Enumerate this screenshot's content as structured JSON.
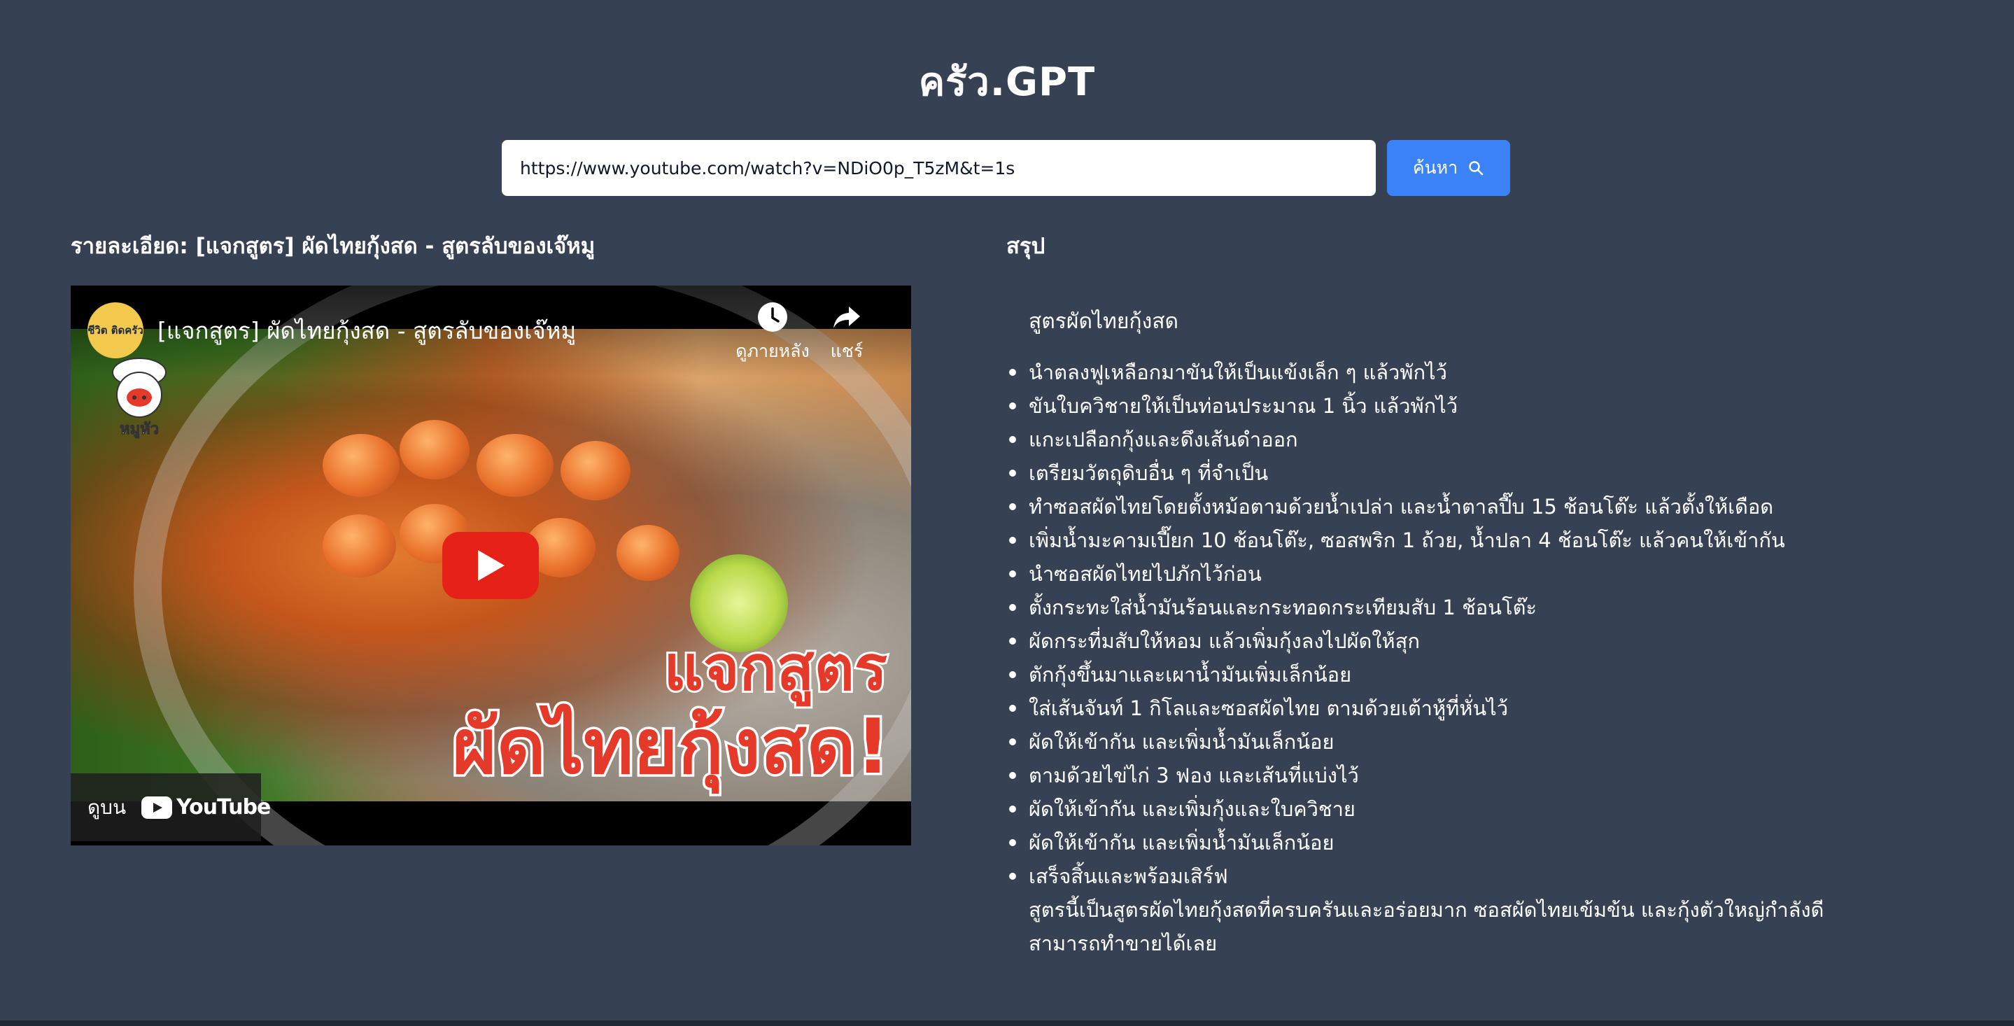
{
  "app": {
    "title": "ครัว.GPT"
  },
  "search": {
    "value": "https://www.youtube.com/watch?v=NDiO0p_T5zM&t=1s",
    "button_label": "ค้นหา"
  },
  "details": {
    "heading": "รายละเอียด: [แจกสูตร] ผัดไทยกุ้งสด - สูตรลับของเจ๊หมู"
  },
  "video": {
    "title": "[แจกสูตร] ผัดไทยกุ้งสด - สูตรลับของเจ๊หมู",
    "channel_logo_text": "ชีวิต ติดครัว",
    "watch_later_label": "ดูภายหลัง",
    "share_label": "แชร์",
    "watch_on_label": "ดูบน",
    "youtube_label": "YouTube",
    "thumbnail_text_1": "แจกสูตร",
    "thumbnail_text_2": "ผัดไทยกุ้งสด!",
    "mascot_text": "หมูหัว"
  },
  "summary": {
    "heading": "สรุป",
    "recipe_title": "สูตรผัดไทยกุ้งสด",
    "steps": [
      "นำตลงฟูเหลือกมาขันให้เป็นแข้งเล็ก ๆ แล้วพักไว้",
      "ขันใบควิชายให้เป็นท่อนประมาณ 1 นิ้ว แล้วพักไว้",
      "แกะเปลือกกุ้งและดึงเส้นดำออก",
      "เตรียมวัตถุดิบอื่น ๆ ที่จำเป็น",
      "ทำซอสผัดไทยโดยตั้งหม้อตามด้วยน้ำเปล่า และน้ำตาลปี๊บ 15 ช้อนโต๊ะ แล้วตั้งให้เดือด",
      "เพิ่มน้ำมะคามเปี๊ยก 10 ช้อนโต๊ะ, ซอสพริก 1 ถ้วย, น้ำปลา 4 ช้อนโต๊ะ แล้วคนให้เข้ากัน",
      "นำซอสผัดไทยไปภักไว้ก่อน",
      "ตั้งกระทะใส่น้ำมันร้อนและกระทอดกระเทียมสับ 1 ช้อนโต๊ะ",
      "ผัดกระที่มสับให้หอม แล้วเพิ่มกุ้งลงไปผัดให้สุก",
      "ตักกุ้งขึ้นมาและเผาน้ำมันเพิ่มเล็กน้อย",
      "ใส่เส้นจันท์ 1 กิโลและซอสผัดไทย ตามด้วยเต้าหู้ที่หั่นไว้",
      "ผัดให้เข้ากัน และเพิ่มน้ำมันเล็กน้อย",
      "ตามด้วยไข่ไก่ 3 ฟอง และเส้นที่แบ่งไว้",
      "ผัดให้เข้ากัน และเพิ่มกุ้งและใบควิชาย",
      "ผัดให้เข้ากัน และเพิ่มน้ำมันเล็กน้อย",
      "เสร็จสิ้นและพร้อมเสิร์ฟ"
    ],
    "conclusion": "สูตรนี้เป็นสูตรผัดไทยกุ้งสดที่ครบครันและอร่อยมาก ซอสผัดไทยเข้มข้น และกุ้งตัวใหญ่กำลังดี สามารถทำขายได้เลย"
  },
  "colors": {
    "background": "#364153",
    "accent": "#3b82f6",
    "play_red": "#e62117",
    "text": "#ffffff"
  }
}
